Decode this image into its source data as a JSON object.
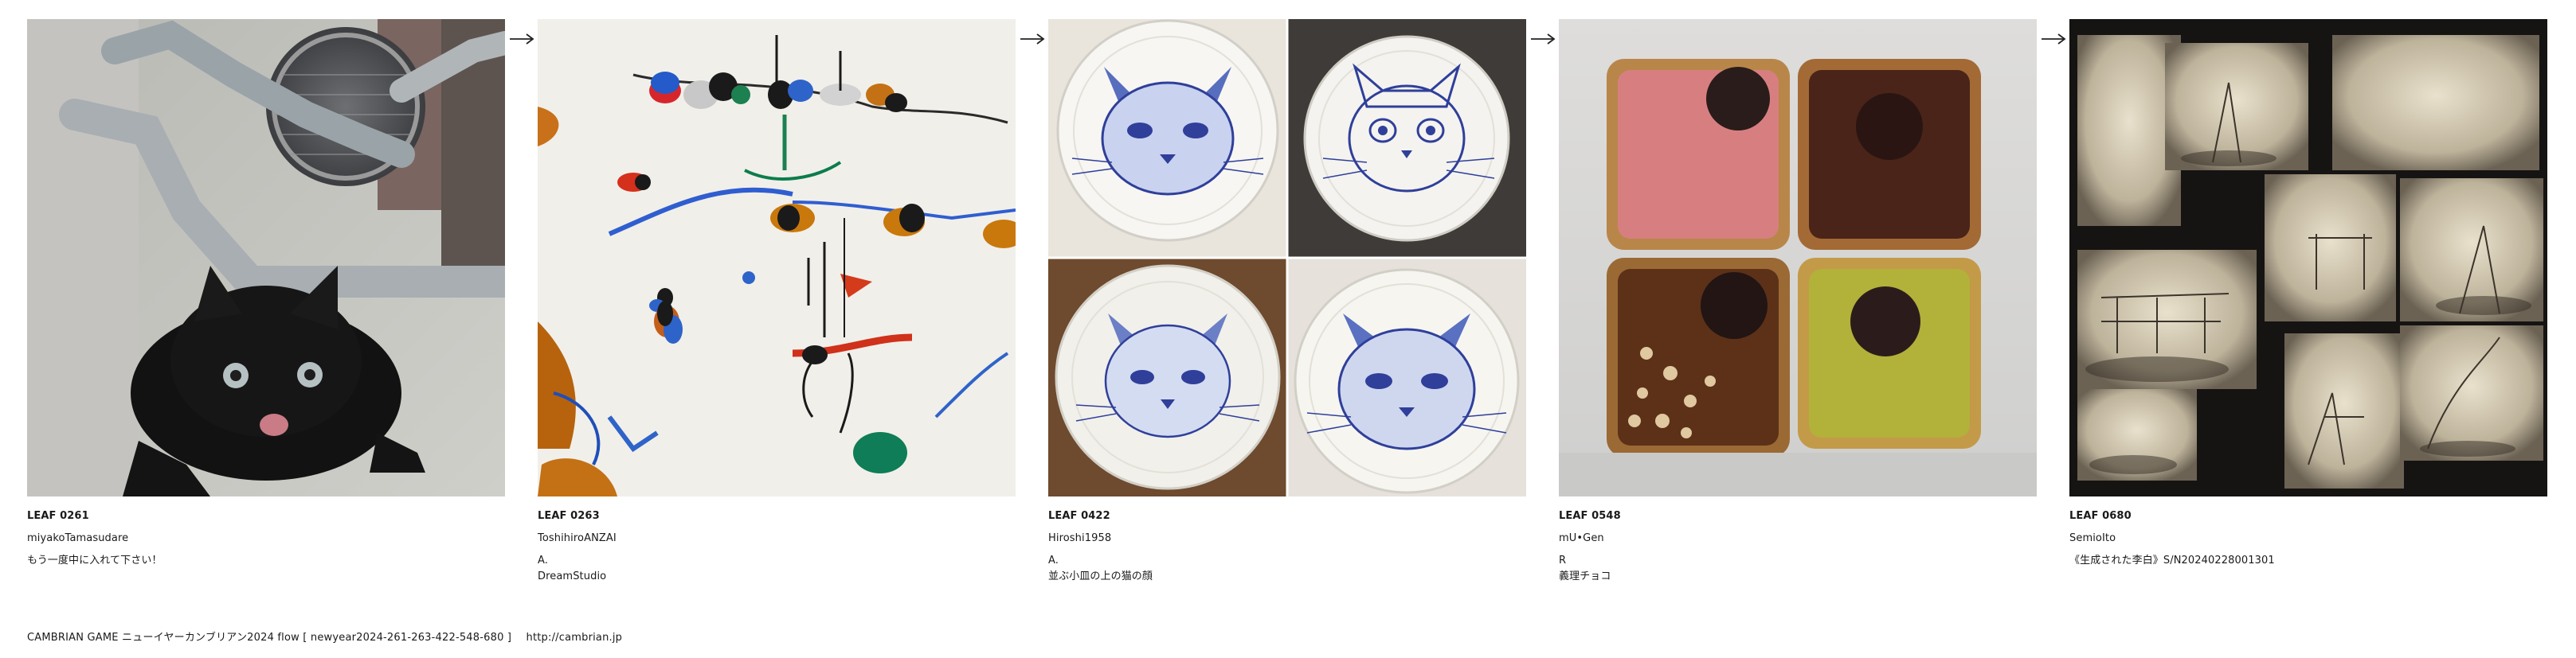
{
  "leaves": [
    {
      "id_label": "LEAF 0261",
      "author": "miyakoTamasudare",
      "caption_lines": [
        "もう一度中に入れて下さい！"
      ],
      "image_icon": "black-kitten-photo"
    },
    {
      "id_label": "LEAF 0263",
      "author": "ToshihiroANZAI",
      "caption_lines": [
        "A.",
        "DreamStudio"
      ],
      "image_icon": "abstract-painting"
    },
    {
      "id_label": "LEAF 0422",
      "author": "Hiroshi1958",
      "caption_lines": [
        "A.",
        "並ぶ小皿の上の猫の顔"
      ],
      "image_icon": "cat-plates-grid"
    },
    {
      "id_label": "LEAF 0548",
      "author": "mU•Gen",
      "caption_lines": [
        "R",
        "義理チョコ"
      ],
      "image_icon": "chocolate-tarts-photo"
    },
    {
      "id_label": "LEAF 0680",
      "author": "SemioIto",
      "caption_lines": [
        "《生成された李白》S/N20240228001301"
      ],
      "image_icon": "sepia-photo-collage"
    }
  ],
  "arrow_icon": "right-arrow-icon",
  "footer": {
    "title": "CAMBRIAN GAME  ニューイヤーカンブリアン2024  flow [ newyear2024-261-263-422-548-680 ]",
    "url": "http://cambrian.jp"
  },
  "colors": {
    "text": "#1a1a1a",
    "background": "#ffffff",
    "plate_blue": "#2f3f9a"
  }
}
